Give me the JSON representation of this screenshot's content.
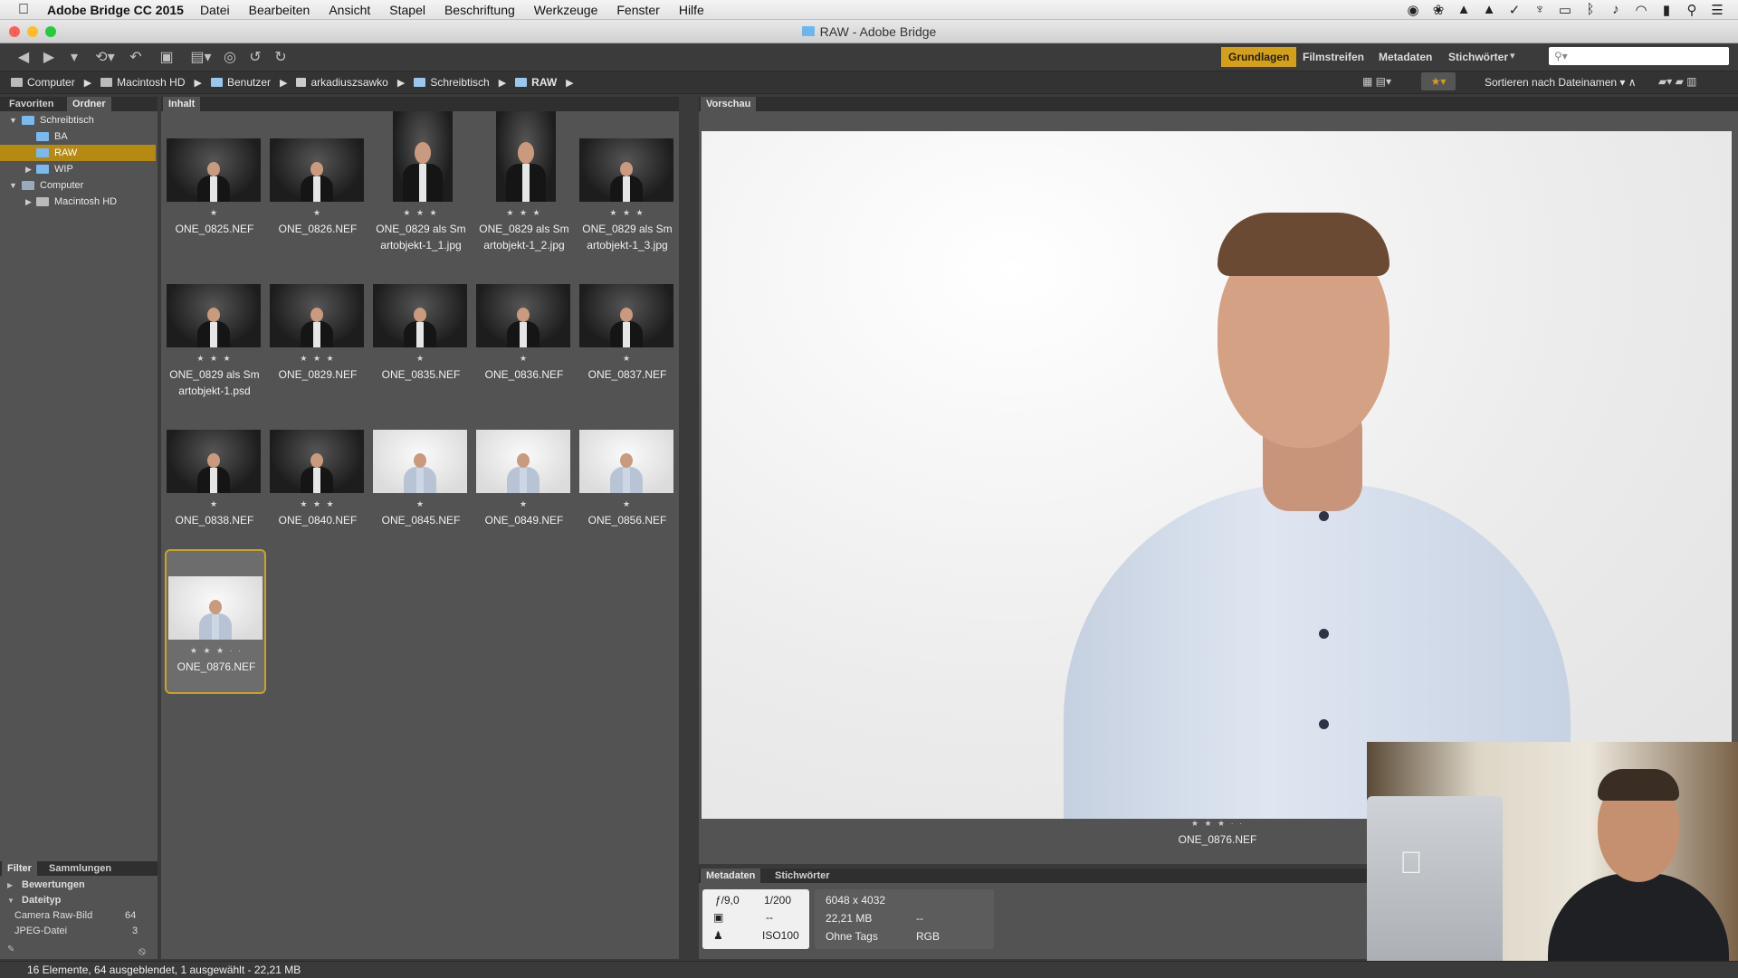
{
  "menubar": {
    "app_name": "Adobe Bridge CC 2015",
    "items": [
      "Datei",
      "Bearbeiten",
      "Ansicht",
      "Stapel",
      "Beschriftung",
      "Werkzeuge",
      "Fenster",
      "Hilfe"
    ]
  },
  "window": {
    "title": "RAW - Adobe Bridge"
  },
  "workspaces": {
    "active": "Grundlagen",
    "items": [
      "Grundlagen",
      "Filmstreifen",
      "Metadaten",
      "Stichwörter"
    ]
  },
  "search": {
    "placeholder": ""
  },
  "breadcrumb": [
    "Computer",
    "Macintosh HD",
    "Benutzer",
    "arkadiuszsawko",
    "Schreibtisch",
    "RAW"
  ],
  "sort": {
    "label": "Sortieren nach Dateinamen"
  },
  "left_panel": {
    "tabs": [
      "Favoriten",
      "Ordner"
    ],
    "active_tab": "Ordner",
    "tree": [
      {
        "label": "Schreibtisch",
        "level": 0,
        "expanded": true
      },
      {
        "label": "BA",
        "level": 1
      },
      {
        "label": "RAW",
        "level": 1,
        "selected": true
      },
      {
        "label": "WIP",
        "level": 1
      },
      {
        "label": "Computer",
        "level": 0,
        "expanded": true
      },
      {
        "label": "Macintosh HD",
        "level": 1
      }
    ]
  },
  "content": {
    "tab": "Inhalt",
    "items": [
      {
        "line1": "ONE_0825.NEF",
        "line2": "",
        "stars": "★",
        "style": "dark"
      },
      {
        "line1": "ONE_0826.NEF",
        "line2": "",
        "stars": "★",
        "style": "dark"
      },
      {
        "line1": "ONE_0829 als Sm",
        "line2": "artobjekt-1_1.jpg",
        "stars": "★ ★ ★",
        "style": "dark-tall"
      },
      {
        "line1": "ONE_0829 als Sm",
        "line2": "artobjekt-1_2.jpg",
        "stars": "★ ★ ★",
        "style": "dark-tall"
      },
      {
        "line1": "ONE_0829 als Sm",
        "line2": "artobjekt-1_3.jpg",
        "stars": "★ ★ ★",
        "style": "dark"
      },
      {
        "line1": "ONE_0829 als Sm",
        "line2": "artobjekt-1.psd",
        "stars": "★ ★ ★",
        "style": "dark"
      },
      {
        "line1": "ONE_0829.NEF",
        "line2": "",
        "stars": "★ ★ ★",
        "style": "dark"
      },
      {
        "line1": "ONE_0835.NEF",
        "line2": "",
        "stars": "★",
        "style": "dark"
      },
      {
        "line1": "ONE_0836.NEF",
        "line2": "",
        "stars": "★",
        "style": "dark"
      },
      {
        "line1": "ONE_0837.NEF",
        "line2": "",
        "stars": "★",
        "style": "dark"
      },
      {
        "line1": "ONE_0838.NEF",
        "line2": "",
        "stars": "★",
        "style": "dark"
      },
      {
        "line1": "ONE_0840.NEF",
        "line2": "",
        "stars": "★ ★ ★",
        "style": "dark"
      },
      {
        "line1": "ONE_0845.NEF",
        "line2": "",
        "stars": "★",
        "style": "light"
      },
      {
        "line1": "ONE_0849.NEF",
        "line2": "",
        "stars": "★",
        "style": "light"
      },
      {
        "line1": "ONE_0856.NEF",
        "line2": "",
        "stars": "★",
        "style": "light"
      },
      {
        "line1": "ONE_0876.NEF",
        "line2": "",
        "stars": "★ ★ ★ · ·",
        "style": "light",
        "selected": true
      }
    ]
  },
  "preview": {
    "tab": "Vorschau",
    "caption": "ONE_0876.NEF",
    "stars": "★ ★ ★ · ·"
  },
  "metadata": {
    "tabs": [
      "Metadaten",
      "Stichwörter"
    ],
    "aperture": "ƒ/9,0",
    "shutter": "1/200",
    "metering": "--",
    "iso": "ISO100",
    "dimensions": "6048 x 4032",
    "filesize": "22,21 MB",
    "filesize_extra": "--",
    "tags": "Ohne Tags",
    "colormode": "RGB"
  },
  "filter": {
    "tabs": [
      "Filter",
      "Sammlungen"
    ],
    "rows": [
      {
        "label": "Bewertungen",
        "count": ""
      },
      {
        "label": "Dateityp",
        "count": ""
      },
      {
        "label": "Camera Raw-Bild",
        "count": "64"
      },
      {
        "label": "JPEG-Datei",
        "count": "3"
      }
    ]
  },
  "status": {
    "text": "16 Elemente, 64 ausgeblendet, 1 ausgewählt - 22,21 MB"
  },
  "colors": {
    "accent": "#d4a016",
    "selection": "#b58a12"
  }
}
